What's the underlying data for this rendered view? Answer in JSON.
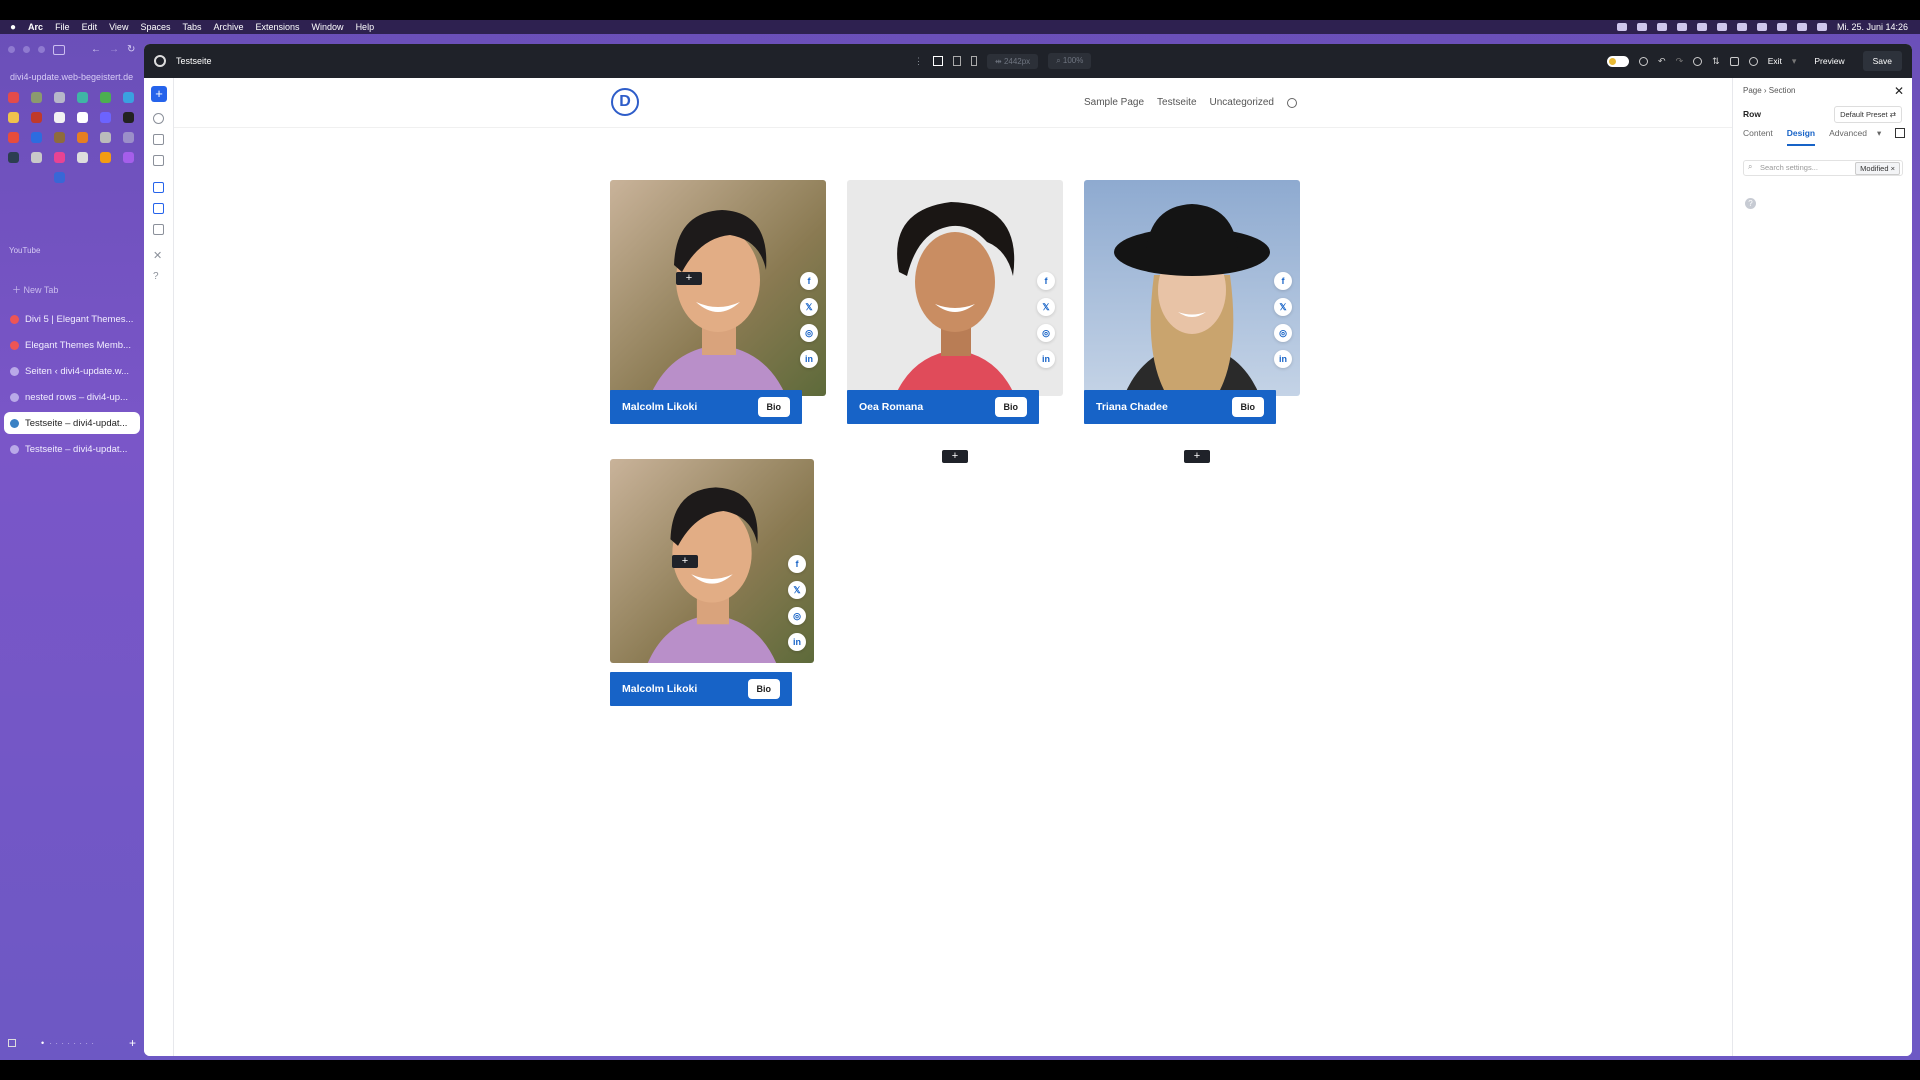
{
  "menubar": {
    "app": "Arc",
    "items": [
      "File",
      "Edit",
      "View",
      "Spaces",
      "Tabs",
      "Archive",
      "Extensions",
      "Window",
      "Help"
    ],
    "clock": "Mi. 25. Juni 14:26"
  },
  "sidebar": {
    "url": "divi4-update.web-begeistert.de",
    "section_label": "YouTube",
    "new_tab": "New Tab",
    "tabs": [
      {
        "label": "Divi 5 | Elegant Themes...",
        "icon": "divi-icon",
        "active": false
      },
      {
        "label": "Elegant Themes Memb...",
        "icon": "divi-icon",
        "active": false
      },
      {
        "label": "Seiten ‹ divi4-update.w...",
        "icon": "wordpress-icon",
        "active": false
      },
      {
        "label": "nested rows – divi4-up...",
        "icon": "wordpress-icon",
        "active": false
      },
      {
        "label": "Testseite – divi4-updat...",
        "icon": "wordpress-icon",
        "active": true
      },
      {
        "label": "Testseite – divi4-updat...",
        "icon": "wordpress-icon",
        "active": false
      }
    ]
  },
  "editor": {
    "page_title": "Testseite",
    "width_field": "2442px",
    "zoom_field": "100%",
    "exit": "Exit",
    "preview": "Preview",
    "save": "Save"
  },
  "site": {
    "logo_letter": "D",
    "nav": [
      "Sample Page",
      "Testseite",
      "Uncategorized"
    ]
  },
  "cards": [
    {
      "name": "Malcolm Likoki",
      "button": "Bio"
    },
    {
      "name": "Oea Romana",
      "button": "Bio"
    },
    {
      "name": "Triana Chadee",
      "button": "Bio"
    },
    {
      "name": "Malcolm Likoki",
      "button": "Bio"
    }
  ],
  "social_glyphs": {
    "facebook": "f",
    "x": "𝕏",
    "instagram": "◎",
    "linkedin": "in"
  },
  "panel": {
    "crumb_page": "Page",
    "crumb_section": "Section",
    "element": "Row",
    "preset": "Default Preset ⇄",
    "tabs": [
      "Content",
      "Design",
      "Advanced"
    ],
    "search_placeholder": "Search settings...",
    "modified": "Modified"
  },
  "colors": {
    "accent": "#1763c7",
    "sidebar": "#6a4fb8",
    "topbar": "#1f2229"
  }
}
